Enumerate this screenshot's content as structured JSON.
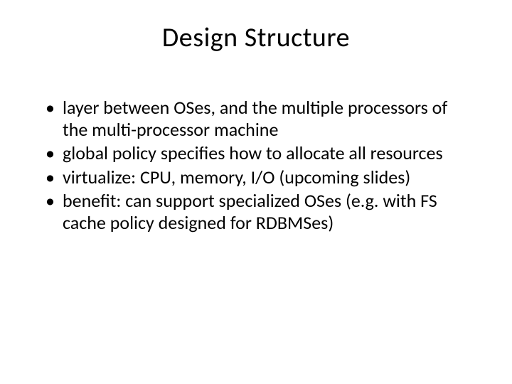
{
  "slide": {
    "title": "Design Structure",
    "bullets": [
      "layer between OSes, and the multiple processors of the multi-processor machine",
      "global policy specifies how to allocate all resources",
      "virtualize: CPU, memory, I/O (upcoming slides)",
      "benefit: can support specialized OSes (e.g. with FS cache policy designed for RDBMSes)"
    ]
  }
}
